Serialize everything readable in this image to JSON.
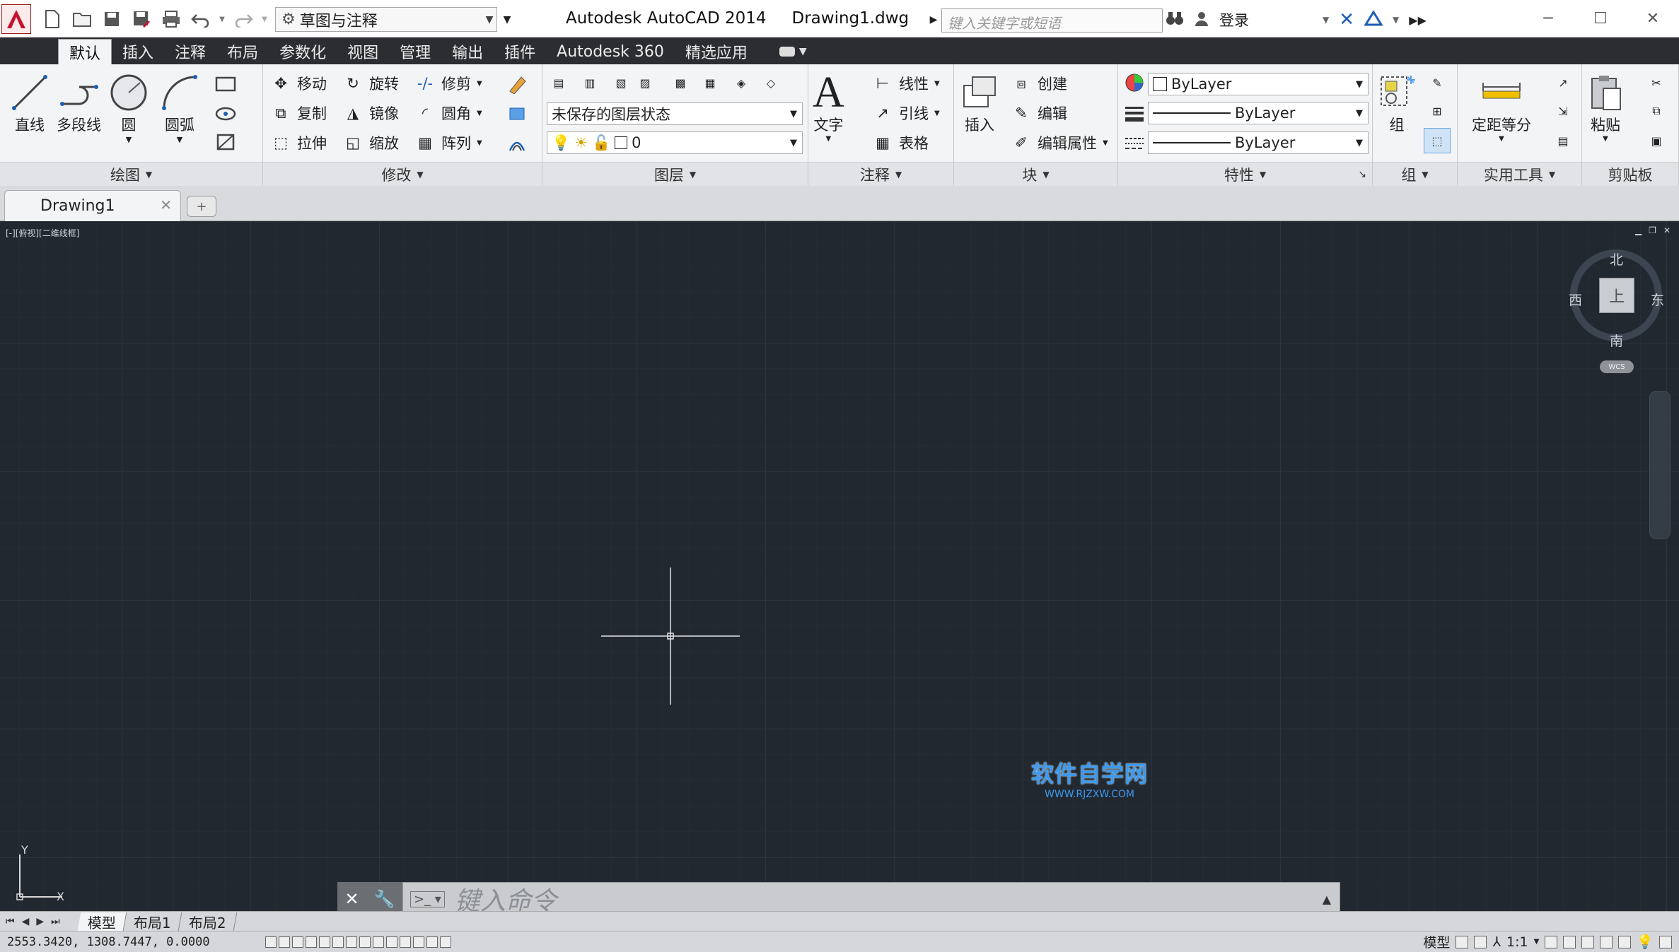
{
  "title_bar": {
    "app_title": "Autodesk AutoCAD 2014",
    "file_name": "Drawing1.dwg",
    "workspace": "草图与注释",
    "search_placeholder": "键入关键字或短语",
    "login_label": "登录"
  },
  "menu_tabs": [
    "默认",
    "插入",
    "注释",
    "布局",
    "参数化",
    "视图",
    "管理",
    "输出",
    "插件",
    "Autodesk 360",
    "精选应用"
  ],
  "ribbon": {
    "draw": {
      "title": "绘图",
      "line": "直线",
      "polyline": "多段线",
      "circle": "圆",
      "arc": "圆弧"
    },
    "modify": {
      "title": "修改",
      "move": "移动",
      "rotate": "旋转",
      "trim": "修剪",
      "copy": "复制",
      "mirror": "镜像",
      "fillet": "圆角",
      "stretch": "拉伸",
      "scale": "缩放",
      "array": "阵列"
    },
    "layers": {
      "title": "图层",
      "layer_state": "未保存的图层状态",
      "current_layer": "0"
    },
    "annotation": {
      "title": "注释",
      "text": "文字",
      "linear": "线性",
      "leader": "引线",
      "table": "表格"
    },
    "block": {
      "title": "块",
      "insert": "插入",
      "create": "创建",
      "edit": "编辑",
      "edit_attributes": "编辑属性"
    },
    "properties": {
      "title": "特性",
      "color": "ByLayer",
      "lineweight": "ByLayer",
      "linetype": "ByLayer"
    },
    "groups": {
      "title": "组",
      "group": "组"
    },
    "utilities": {
      "title": "实用工具",
      "measure": "定距等分"
    },
    "clipboard": {
      "title": "剪贴板",
      "paste": "粘贴"
    }
  },
  "file_tab": {
    "name": "Drawing1"
  },
  "viewport": {
    "label": "[-][俯视][二维线框]",
    "compass": {
      "north": "北",
      "south": "南",
      "east": "东",
      "west": "西",
      "top": "上"
    },
    "wcs": "WCS",
    "ucs_y": "Y",
    "ucs_x": "X"
  },
  "watermark": {
    "main": "软件自学网",
    "sub": "WWW.RJZXW.COM"
  },
  "command_line": {
    "placeholder": "键入命令"
  },
  "layout_tabs": [
    "模型",
    "布局1",
    "布局2"
  ],
  "status": {
    "coordinates": "2553.3420, 1308.7447, 0.0000",
    "model": "模型",
    "scale": "1:1"
  },
  "colors": {
    "canvas": "#212830",
    "menubar": "#2b2d31",
    "ribbon": "#f3f4f6",
    "accent_red": "#c8102e"
  }
}
